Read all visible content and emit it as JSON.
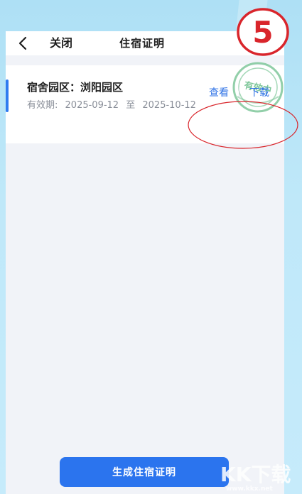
{
  "nav": {
    "close_label": "关闭",
    "title": "住宿证明"
  },
  "card": {
    "title": "宿舍园区：浏阳园区",
    "validity_label": "有效期:",
    "start_date": "2025-09-12",
    "range_word": "至",
    "end_date": "2025-10-12",
    "stamp_text": "有效中",
    "view_label": "查看",
    "download_label": "下载"
  },
  "button": {
    "generate_label": "生成住宿证明"
  },
  "annotation": {
    "step_number": "5"
  },
  "watermark": {
    "logo_text": "KK下载",
    "url": "www.kkx.net"
  },
  "colors": {
    "accent": "#2b74ee",
    "link": "#2e72e6",
    "stamp": "#7fc79a",
    "annotation": "#d9252b",
    "page_bg": "#f1f3f8",
    "outer_bg": "#bfe6f7"
  }
}
